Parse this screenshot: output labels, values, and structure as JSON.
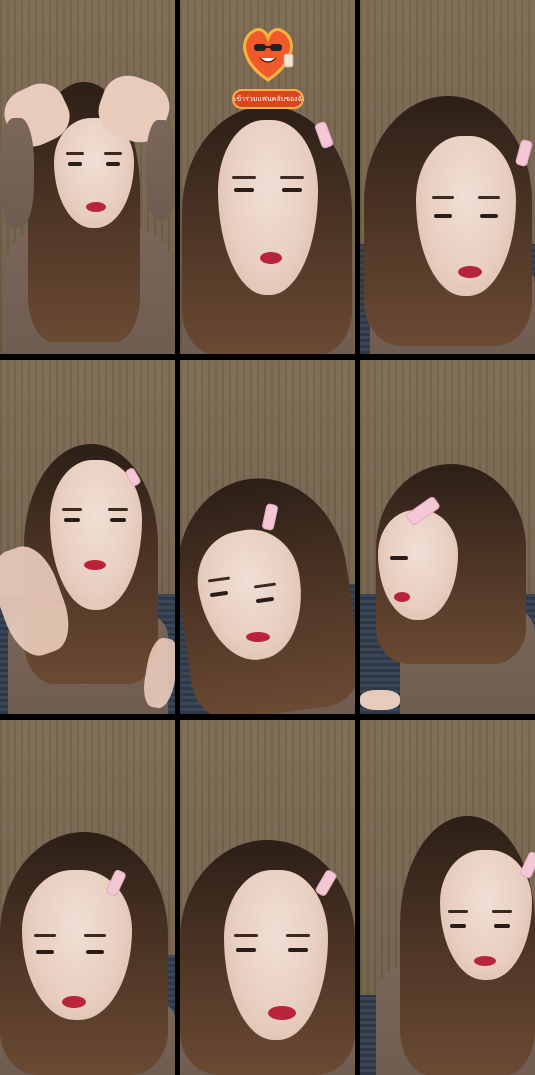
{
  "collage": {
    "layout": "3x3 grid of video frames",
    "frames": [
      {
        "id": 1,
        "pose": "hands-on-head"
      },
      {
        "id": 2,
        "pose": "facing-camera",
        "has_sticker": true
      },
      {
        "id": 3,
        "pose": "looking-down"
      },
      {
        "id": 4,
        "pose": "waving"
      },
      {
        "id": 5,
        "pose": "tilted-head"
      },
      {
        "id": 6,
        "pose": "profile-left"
      },
      {
        "id": 7,
        "pose": "looking-down"
      },
      {
        "id": 8,
        "pose": "talking"
      },
      {
        "id": 9,
        "pose": "looking-down"
      }
    ]
  },
  "sticker": {
    "label": "เข้าร่วมแฟนคลับของฉัน",
    "icon": "heart-mascot-icon"
  },
  "colors": {
    "background_wall": "#7d6a53",
    "grid_border": "#000000",
    "sticker_label_bg": "#d8461e",
    "lips": "#b8253a"
  }
}
